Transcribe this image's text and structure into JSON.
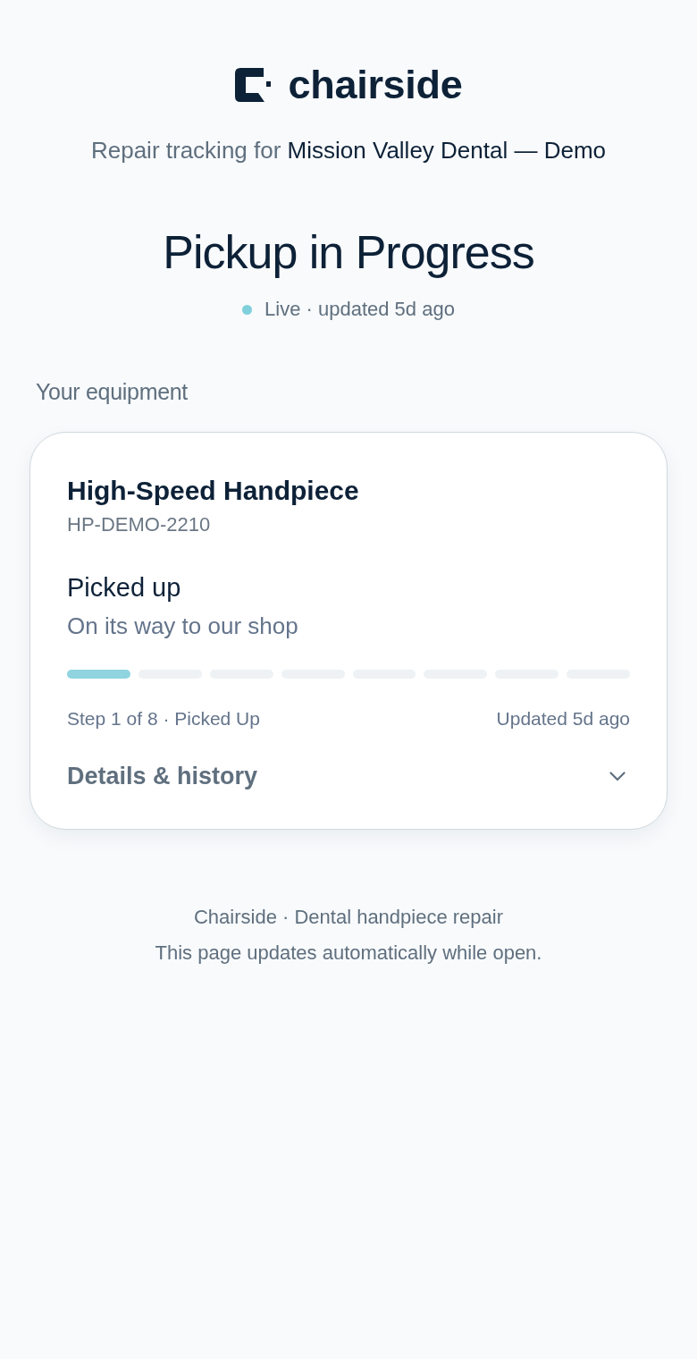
{
  "brand": {
    "name": "chairside"
  },
  "header": {
    "intro": "Repair tracking for",
    "clinic": "Mission Valley Dental — Demo"
  },
  "status": {
    "title": "Pickup in Progress",
    "live_text": "Live · updated 5d ago"
  },
  "section_label": "Your equipment",
  "equipment": [
    {
      "name": "High-Speed Handpiece",
      "serial": "HP-DEMO-2210",
      "stage": "Picked up",
      "stage_detail": "On its way to our shop",
      "steps": [
        {
          "completed": true
        },
        {
          "completed": false
        },
        {
          "completed": false
        },
        {
          "completed": false
        },
        {
          "completed": false
        },
        {
          "completed": false
        },
        {
          "completed": false
        },
        {
          "completed": false
        }
      ],
      "step_text": "Step 1 of 8 · Picked Up",
      "updated": "Updated 5d ago",
      "details_label": "Details & history",
      "expanded": false
    }
  ],
  "footer": [
    "Chairside · Dental handpiece repair",
    "This page updates automatically while open."
  ]
}
